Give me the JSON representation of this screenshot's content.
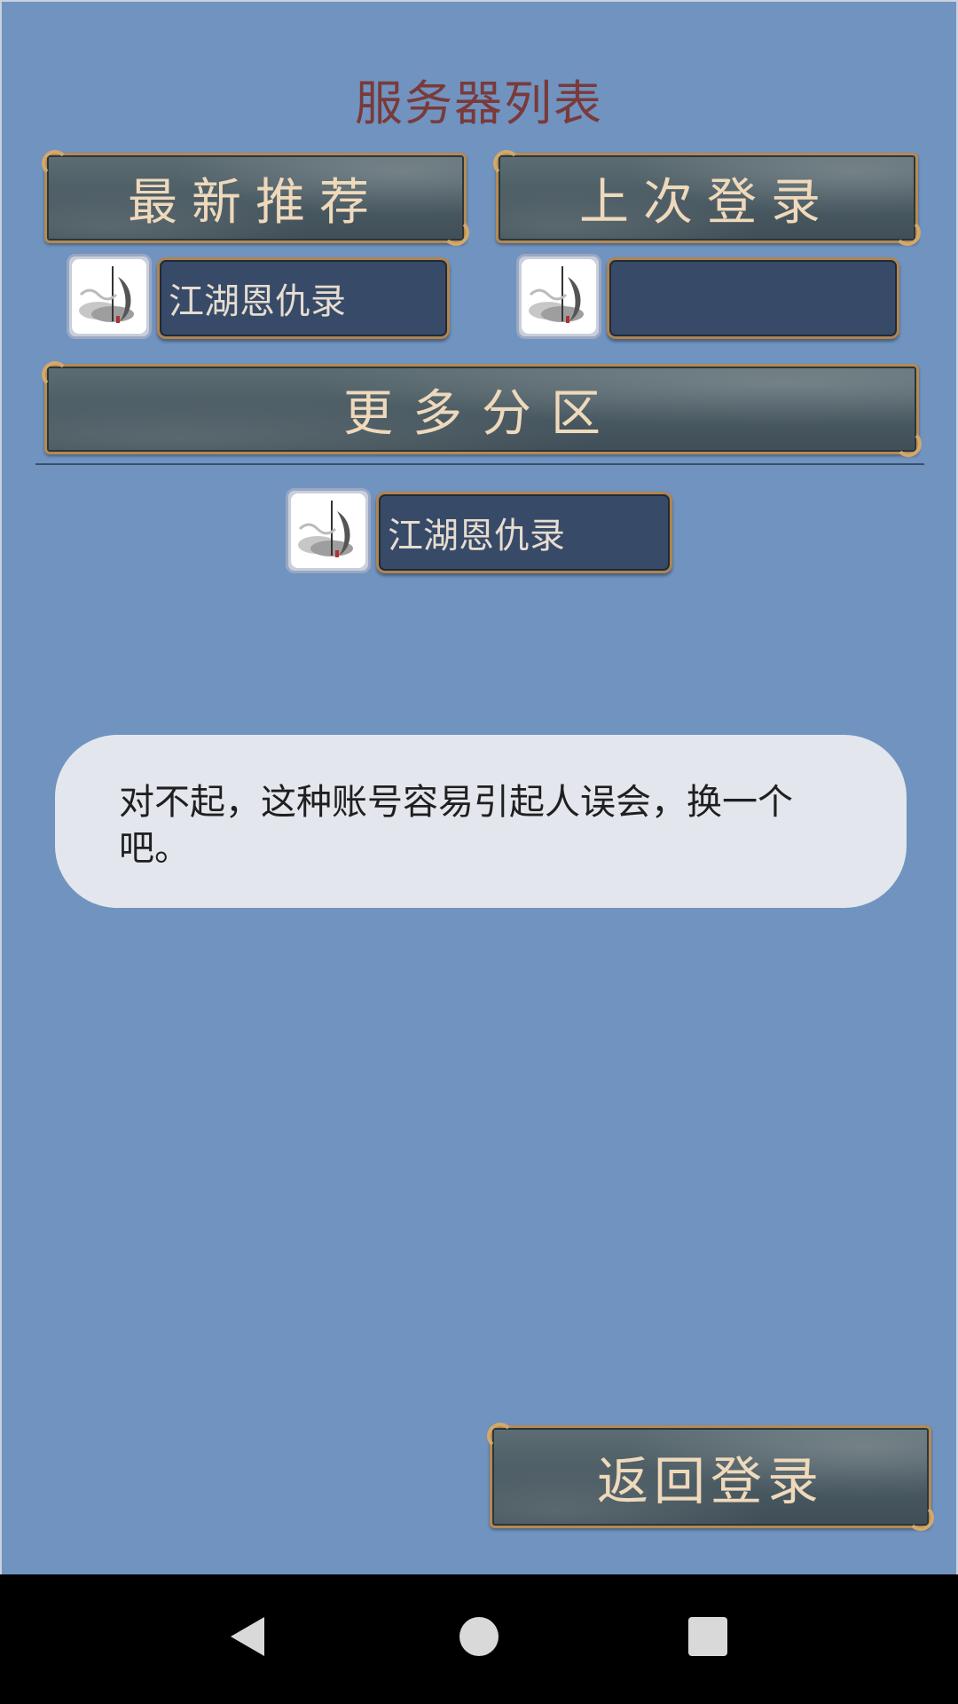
{
  "header": {
    "title": "服务器列表"
  },
  "tabs": {
    "newest": "最新推荐",
    "last_login": "上次登录"
  },
  "recommended_server": {
    "name": "江湖恩仇录"
  },
  "last_server": {
    "name": ""
  },
  "more_zones": {
    "label": "更多分区"
  },
  "zone_server": {
    "name": "江湖恩仇录"
  },
  "toast": {
    "message": "对不起，这种账号容易引起人误会，换一个吧。"
  },
  "footer": {
    "back_label": "返回登录"
  },
  "icons": {
    "server": "game-logo-icon",
    "nav_back": "triangle-back-icon",
    "nav_home": "circle-home-icon",
    "nav_recent": "square-recents-icon"
  }
}
